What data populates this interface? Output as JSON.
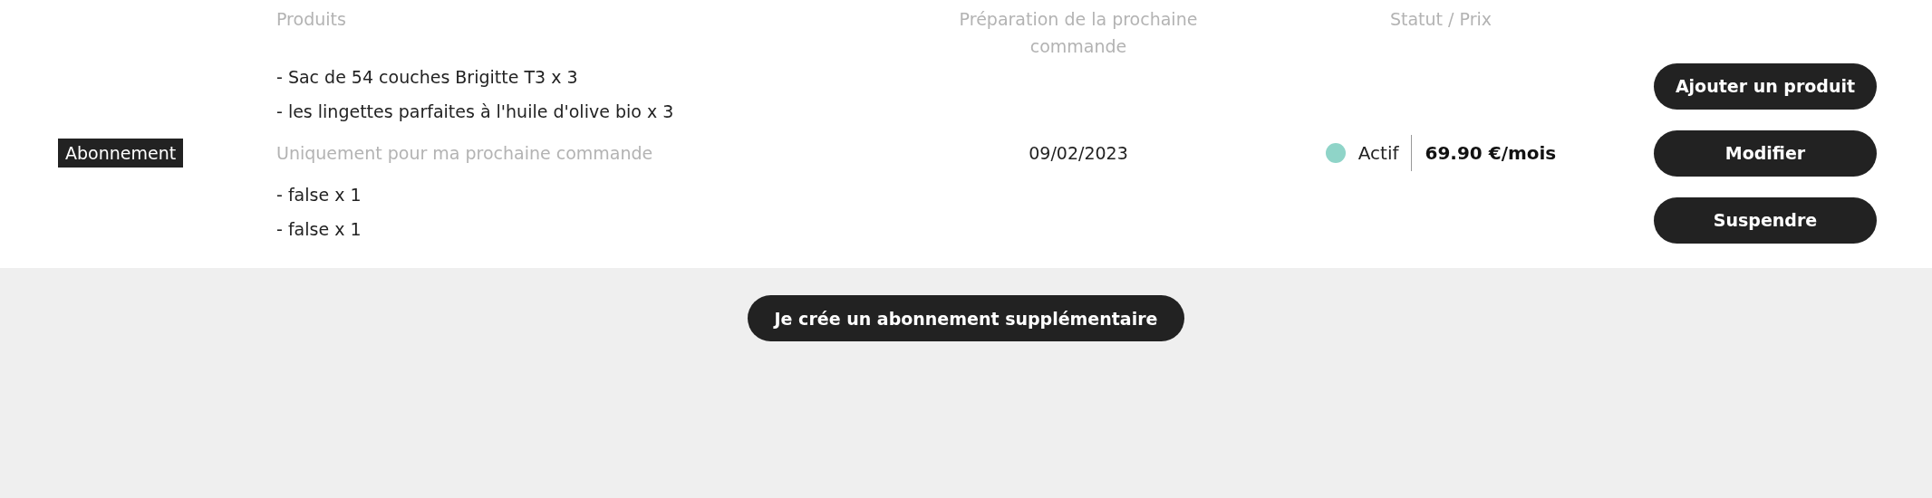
{
  "subscription": {
    "badge": "Abonnement",
    "columns": [
      "Produits",
      "Préparation de la prochaine commande",
      "Statut / Prix"
    ],
    "products": [
      "- Sac de 54 couches Brigitte T3 x 3",
      "- les lingettes parfaites à l'huile d'olive bio x 3"
    ],
    "one_time_label": "Uniquement pour ma prochaine commande",
    "one_time_products": [
      "- false x 1",
      "- false x 1"
    ],
    "next_order_date": "09/02/2023",
    "status": "Actif",
    "price": "69.90 €/mois",
    "actions": [
      "Ajouter un produit",
      "Modifier",
      "Suspendre"
    ]
  },
  "add_subscription_button": "Je crée un abonnement supplémentaire"
}
